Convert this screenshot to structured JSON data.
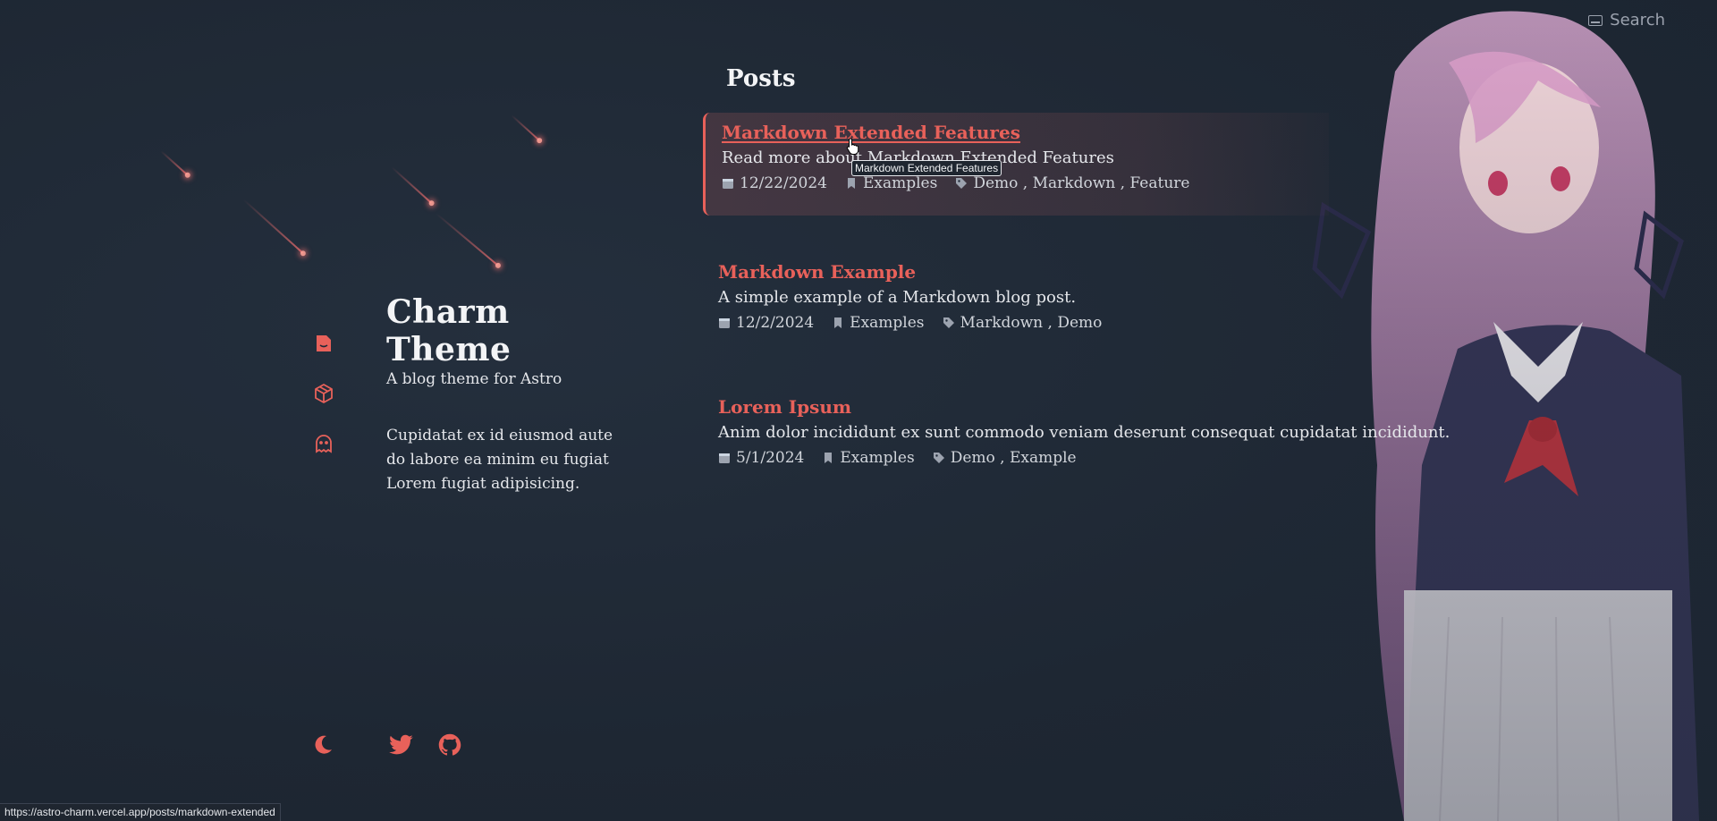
{
  "search": {
    "label": "Search"
  },
  "profile": {
    "name": "Charm Theme",
    "tagline": "A blog theme for Astro",
    "bio": "Cupidatat ex id eiusmod aute do labore ea minim eu fugiat Lorem fugiat adipisicing."
  },
  "sidebar": {
    "icons": [
      "posts-icon",
      "box-icon",
      "ghost-icon"
    ]
  },
  "footer_icons": [
    "moon-icon",
    "twitter-icon",
    "github-icon"
  ],
  "posts_heading": "Posts",
  "posts": [
    {
      "title": "Markdown Extended Features",
      "description": "Read more about Markdown Extended Features",
      "date": "12/22/2024",
      "category": "Examples",
      "tags": [
        "Demo",
        "Markdown",
        "Feature"
      ]
    },
    {
      "title": "Markdown Example",
      "description": "A simple example of a Markdown blog post.",
      "date": "12/2/2024",
      "category": "Examples",
      "tags": [
        "Markdown",
        "Demo"
      ]
    },
    {
      "title": "Lorem Ipsum",
      "description": "Anim dolor incididunt ex sunt commodo veniam deserunt consequat cupidatat incididunt.",
      "date": "5/1/2024",
      "category": "Examples",
      "tags": [
        "Demo",
        "Example"
      ]
    }
  ],
  "tooltip": "Markdown Extended Features",
  "statusbar": {
    "url": "https://astro-charm.vercel.app/posts/markdown-extended"
  },
  "colors": {
    "accent": "#e8615a",
    "background": "#1f2937",
    "text": "#e5e7eb",
    "muted": "#9ca3af"
  }
}
